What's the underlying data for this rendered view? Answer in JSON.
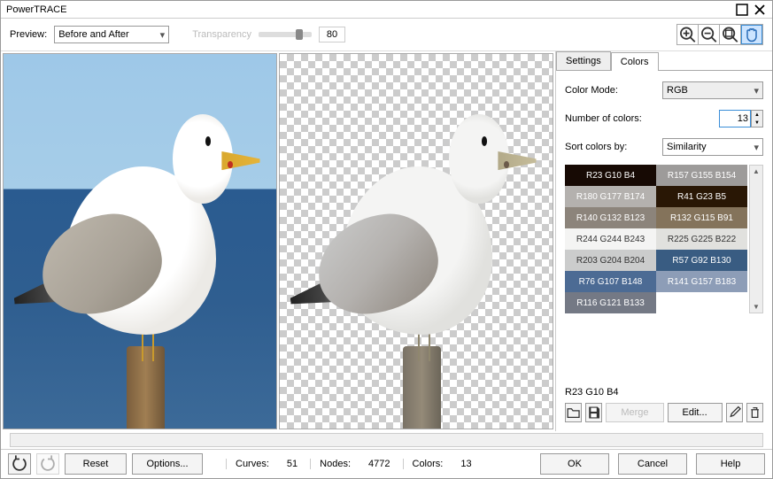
{
  "window": {
    "title": "PowerTRACE"
  },
  "toolbar": {
    "preview_label": "Preview:",
    "preview_mode": "Before and After",
    "transparency_label": "Transparency",
    "transparency_value": "80"
  },
  "right_panel": {
    "tabs": {
      "settings": "Settings",
      "colors": "Colors"
    },
    "color_mode_label": "Color Mode:",
    "color_mode_value": "RGB",
    "num_colors_label": "Number of colors:",
    "num_colors_value": "13",
    "sort_label": "Sort colors by:",
    "sort_value": "Similarity",
    "selected_color": "R23 G10 B4",
    "merge_label": "Merge",
    "edit_label": "Edit..."
  },
  "swatches": [
    {
      "label": "R23 G10 B4",
      "bg": "#170a04",
      "light": false,
      "selected": true
    },
    {
      "label": "R157 G155 B154",
      "bg": "#9d9b9a",
      "light": false
    },
    {
      "label": "R180 G177 B174",
      "bg": "#b4b1ae",
      "light": false
    },
    {
      "label": "R41 G23 B5",
      "bg": "#291705",
      "light": false
    },
    {
      "label": "R140 G132 B123",
      "bg": "#8c847b",
      "light": false
    },
    {
      "label": "R132 G115 B91",
      "bg": "#84735b",
      "light": false
    },
    {
      "label": "R244 G244 B243",
      "bg": "#f4f4f3",
      "light": true
    },
    {
      "label": "R225 G225 B222",
      "bg": "#e1e1de",
      "light": true
    },
    {
      "label": "R203 G204 B204",
      "bg": "#cbcccc",
      "light": true
    },
    {
      "label": "R57 G92 B130",
      "bg": "#395c82",
      "light": false
    },
    {
      "label": "R76 G107 B148",
      "bg": "#4c6b94",
      "light": false
    },
    {
      "label": "R141 G157 B183",
      "bg": "#8d9db7",
      "light": false
    },
    {
      "label": "R116 G121 B133",
      "bg": "#747985",
      "light": false
    }
  ],
  "footer": {
    "reset": "Reset",
    "options": "Options...",
    "curves_label": "Curves:",
    "curves_value": "51",
    "nodes_label": "Nodes:",
    "nodes_value": "4772",
    "colors_label": "Colors:",
    "colors_value": "13",
    "ok": "OK",
    "cancel": "Cancel",
    "help": "Help"
  }
}
